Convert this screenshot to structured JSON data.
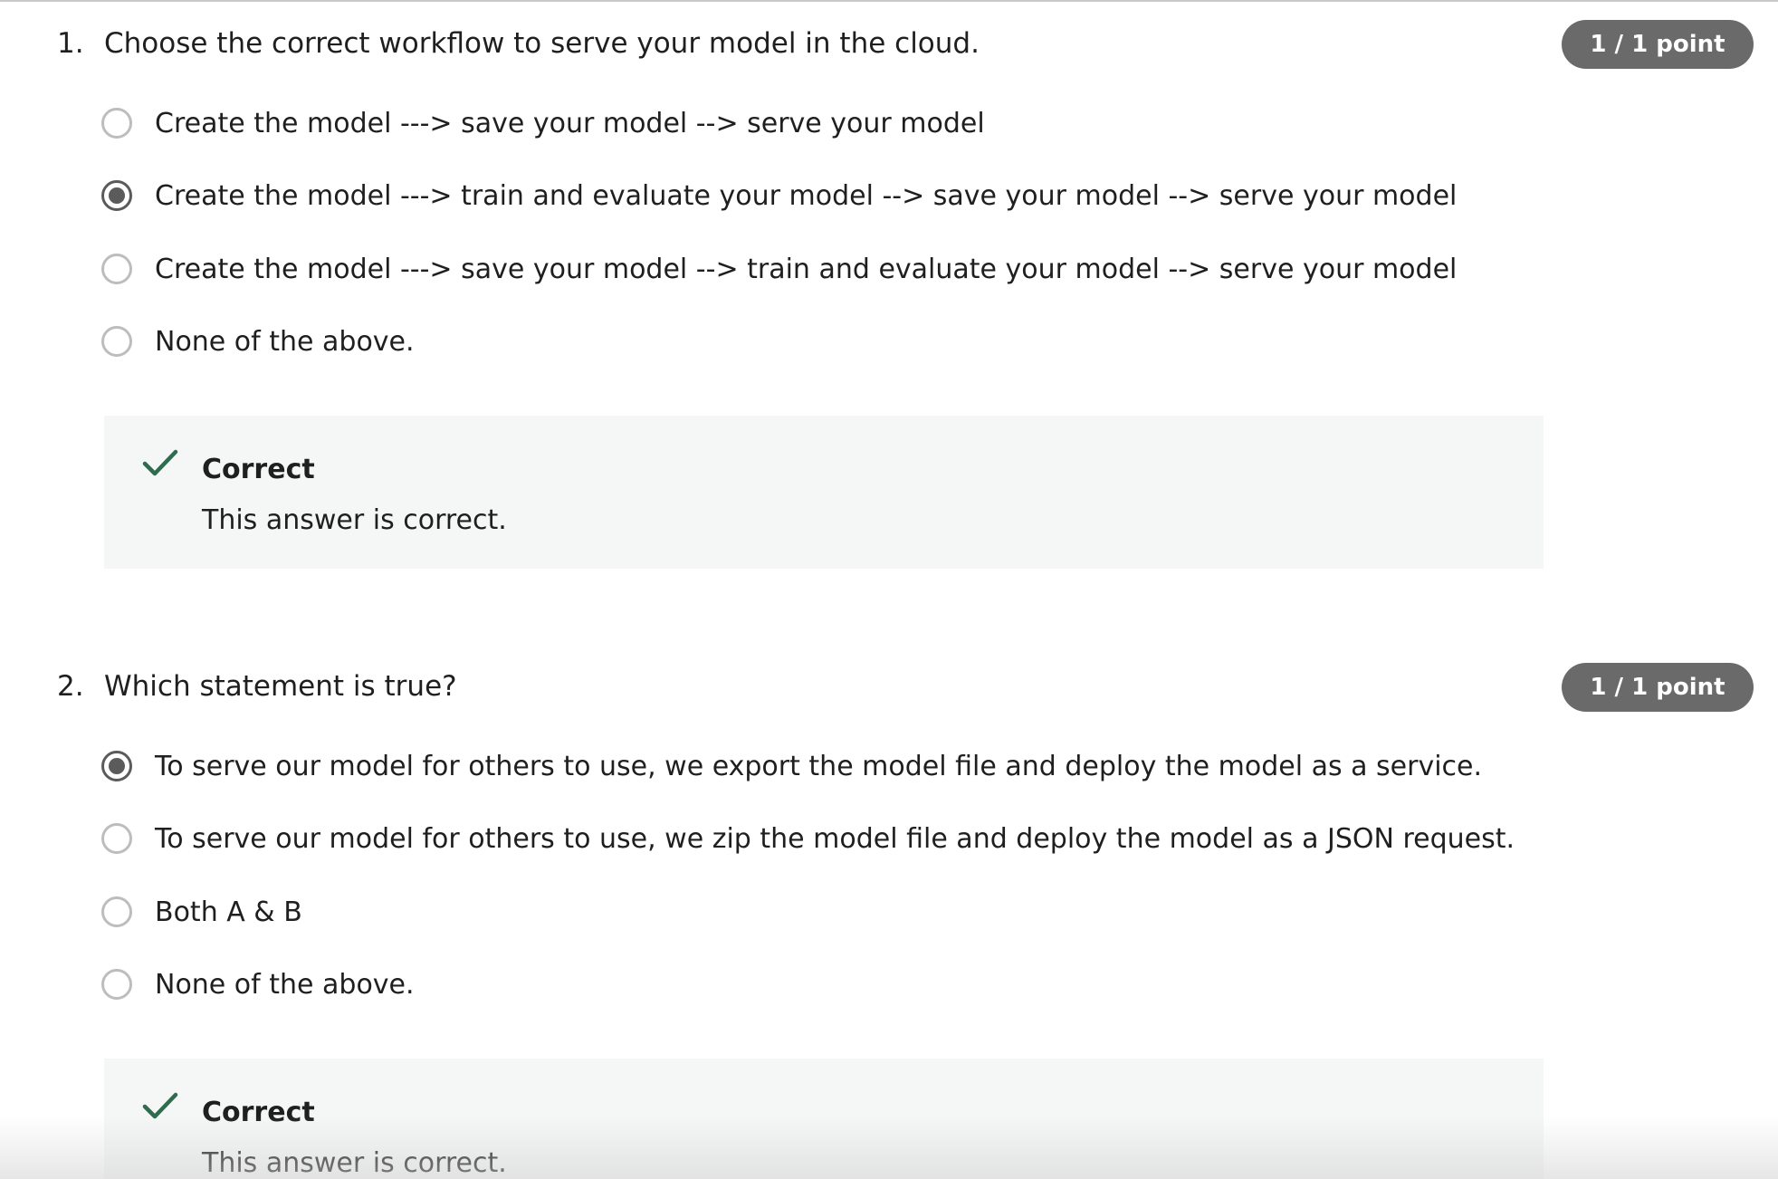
{
  "questions": [
    {
      "number": "1.",
      "text": "Choose the correct workflow to serve your model in the cloud.",
      "points": "1 / 1 point",
      "options": [
        {
          "label": "Create the model ---> save your model --> serve your model",
          "selected": false
        },
        {
          "label": "Create the model ---> train and evaluate your model --> save your model --> serve your model",
          "selected": true
        },
        {
          "label": "Create the model ---> save your model --> train and evaluate your model --> serve your model",
          "selected": false
        },
        {
          "label": "None of the above.",
          "selected": false
        }
      ],
      "feedback": {
        "title": "Correct",
        "text": "This answer is correct."
      }
    },
    {
      "number": "2.",
      "text": "Which statement is true?",
      "points": "1 / 1 point",
      "options": [
        {
          "label": "To serve our model for others to use, we export the model file and deploy the model as a service.",
          "selected": true
        },
        {
          "label": "To serve our model for others to use, we zip the model file and deploy the model as a JSON request.",
          "selected": false
        },
        {
          "label": "Both A & B",
          "selected": false
        },
        {
          "label": "None of the above.",
          "selected": false
        }
      ],
      "feedback": {
        "title": "Correct",
        "text": "This answer is correct."
      }
    }
  ],
  "colors": {
    "badge_bg": "#6a6a6a",
    "check_green": "#2e6b4f",
    "feedback_bg": "#f5f7f6",
    "radio_selected": "#5b5b5b",
    "radio_unselected": "#bdbdbd"
  },
  "icons": {
    "feedback_icon": "check-icon"
  }
}
